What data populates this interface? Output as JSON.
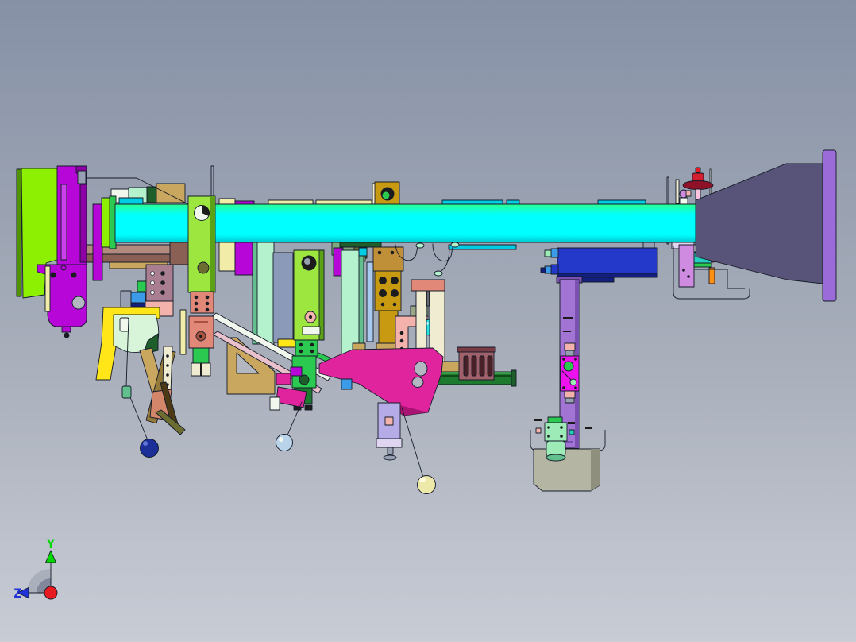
{
  "app": {
    "type": "cad-3d-viewport",
    "view_orientation": "side view"
  },
  "axis_triad": {
    "y_label": "Y",
    "z_label": "Z"
  },
  "colors": {
    "bg_top": "#8691a6",
    "bg_mid": "#a8aeba",
    "bg_bot": "#c8ccd5",
    "beam_hl": "#2bff92",
    "beam_cyan": "#00ffff",
    "beam_low": "#00c9ce",
    "tab_cyan": "#00cde4",
    "chartreuse": "#8df003",
    "chartreuse_dark": "#4f9400",
    "bright_green": "#2bc94f",
    "green_rail": "#1e7a2f",
    "rail_hl": "#3a9a4a",
    "rail_dark": "#0f4a18",
    "dark_green": "#1d5e2a",
    "purple_vivid": "#b607d8",
    "purple_dark": "#8c00a6",
    "purple_lite": "#ca41e9",
    "pink_tube": "#ffc3dd",
    "pink_tube_hl": "#ffe4f0",
    "pink_block": "#f3b3ac",
    "pink_strap": "#e9c1cd",
    "deep_pink": "#e0249d",
    "deep_pink_dark": "#a91371",
    "steel_gray": "#97a0b2",
    "slate_part": "#8b9ab8",
    "white_part": "#f2f7ee",
    "cream": "#efecd2",
    "pale_yellow": "#f1eda9",
    "yellow": "#ffe619",
    "mint": "#b4f2cd",
    "mint_dark": "#63c08e",
    "pale_green_blob": "#d8f5d9",
    "foot_cyl": "#9debb7",
    "foot_green": "#2cc44d",
    "khaki": "#c9a75f",
    "khaki_dark": "#93793a",
    "bronze": "#c09038",
    "gold": "#c79a11",
    "olive_gold": "#8d7d1e",
    "olive": "#6d6d31",
    "dark_brown": "#4c3a16",
    "coral": "#d4866b",
    "sage": "#9aa887",
    "mauve": "#b28a7e",
    "mauve_dark": "#8a6055",
    "rosy_plate": "#a97e90",
    "salmon": "#e28879",
    "salmon_dark": "#a8523f",
    "blue_small": "#3b9be8",
    "navy": "#131f7e",
    "royal_blue": "#2439c9",
    "periwinkle": "#b4abe7",
    "lavender": "#e0d5f1",
    "pale_blue": "#a9c9ee",
    "yellowgreen_arm": "#9ce63f",
    "yellowgreen_dark": "#5ca216",
    "teal_hose": "#75c5ad",
    "teal_block": "#24cebc",
    "cyan_sphere": "#2ce1e1",
    "sphere_hl": "#d0ffff",
    "purple_column": "#a274d3",
    "purple_col_dark": "#7a50b1",
    "magenta_panel": "#ee12ee",
    "violet_plate": "#cf8bdf",
    "funnel": "#585379",
    "funnel_cap": "#9a6bd9",
    "gray_foot": "#b5b5a3",
    "gray_foot_dark": "#8f8f7d",
    "red_cap": "#8e1127",
    "red_knob": "#d32031",
    "orange": "#ff9013",
    "yellow_tube": "#eae464",
    "basket": "#a0616a",
    "basket_dark": "#7a3b45",
    "basket_slot": "#482028",
    "sea_green": "#7dab7f",
    "lt_green": "#a9d87a",
    "navy_ball": "#1c2e97",
    "steel_ball": "#b9d3eb",
    "yellow_ball": "#ece9a9",
    "ball_hl_blue": "#5f74d8",
    "ball_hl_yel": "#fffbdd",
    "arc_gray": "#aab0bb",
    "arc_gray_dark": "#82889b",
    "axis_green": "#00d900",
    "axis_blue": "#2033d6",
    "axis_red": "#e81a21",
    "ink": "#1c1c1c",
    "hole_bg": "#b2b7c2"
  }
}
